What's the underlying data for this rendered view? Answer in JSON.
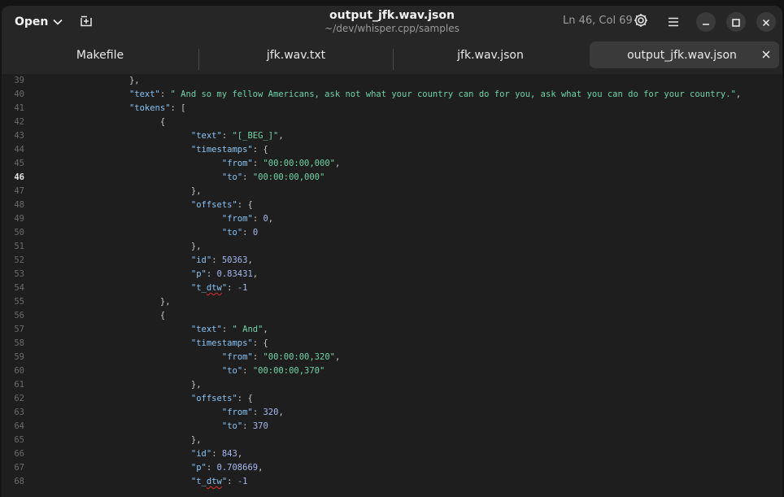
{
  "header": {
    "open_label": "Open",
    "title": "output_jfk.wav.json",
    "subtitle": "~/dev/whisper.cpp/samples",
    "cursor_position": "Ln 46, Col 69"
  },
  "tabs": [
    {
      "label": "Makefile"
    },
    {
      "label": "jfk.wav.txt"
    },
    {
      "label": "jfk.wav.json"
    },
    {
      "label": "output_jfk.wav.json"
    }
  ],
  "editor": {
    "current_line": 46,
    "lines": [
      {
        "n": "39",
        "indent": 6,
        "parts": [
          [
            "p",
            "},"
          ]
        ]
      },
      {
        "n": "40",
        "indent": 6,
        "parts": [
          [
            "k",
            "\"text\""
          ],
          [
            "p",
            ": "
          ],
          [
            "s",
            "\" And so my fellow Americans, ask not what your country can do for you, ask what you can do for your country.\""
          ],
          [
            "p",
            ","
          ]
        ]
      },
      {
        "n": "41",
        "indent": 6,
        "parts": [
          [
            "k",
            "\"tokens\""
          ],
          [
            "p",
            ": ["
          ]
        ]
      },
      {
        "n": "42",
        "indent": 8,
        "parts": [
          [
            "p",
            "{"
          ]
        ]
      },
      {
        "n": "43",
        "indent": 10,
        "parts": [
          [
            "k",
            "\"text\""
          ],
          [
            "p",
            ": "
          ],
          [
            "s",
            "\"[_BEG_]\""
          ],
          [
            "p",
            ","
          ]
        ]
      },
      {
        "n": "44",
        "indent": 10,
        "parts": [
          [
            "k",
            "\"timestamps\""
          ],
          [
            "p",
            ": {"
          ]
        ]
      },
      {
        "n": "45",
        "indent": 12,
        "parts": [
          [
            "k",
            "\"from\""
          ],
          [
            "p",
            ": "
          ],
          [
            "s",
            "\"00:00:00,000\""
          ],
          [
            "p",
            ","
          ]
        ]
      },
      {
        "n": "46",
        "indent": 12,
        "parts": [
          [
            "k",
            "\"to\""
          ],
          [
            "p",
            ": "
          ],
          [
            "s",
            "\"00:00:00,000\""
          ]
        ]
      },
      {
        "n": "47",
        "indent": 10,
        "parts": [
          [
            "p",
            "},"
          ]
        ]
      },
      {
        "n": "48",
        "indent": 10,
        "parts": [
          [
            "k",
            "\"offsets\""
          ],
          [
            "p",
            ": {"
          ]
        ]
      },
      {
        "n": "49",
        "indent": 12,
        "parts": [
          [
            "k",
            "\"from\""
          ],
          [
            "p",
            ": "
          ],
          [
            "n",
            "0"
          ],
          [
            "p",
            ","
          ]
        ]
      },
      {
        "n": "50",
        "indent": 12,
        "parts": [
          [
            "k",
            "\"to\""
          ],
          [
            "p",
            ": "
          ],
          [
            "n",
            "0"
          ]
        ]
      },
      {
        "n": "51",
        "indent": 10,
        "parts": [
          [
            "p",
            "},"
          ]
        ]
      },
      {
        "n": "52",
        "indent": 10,
        "parts": [
          [
            "k",
            "\"id\""
          ],
          [
            "p",
            ": "
          ],
          [
            "n",
            "50363"
          ],
          [
            "p",
            ","
          ]
        ]
      },
      {
        "n": "53",
        "indent": 10,
        "parts": [
          [
            "k",
            "\"p\""
          ],
          [
            "p",
            ": "
          ],
          [
            "n",
            "0.83431"
          ],
          [
            "p",
            ","
          ]
        ]
      },
      {
        "n": "54",
        "indent": 10,
        "parts": [
          [
            "k",
            "\"t_"
          ],
          [
            "kw",
            "dtw"
          ],
          [
            "k",
            "\""
          ],
          [
            "p",
            ": "
          ],
          [
            "n",
            "-1"
          ]
        ]
      },
      {
        "n": "55",
        "indent": 8,
        "parts": [
          [
            "p",
            "},"
          ]
        ]
      },
      {
        "n": "56",
        "indent": 8,
        "parts": [
          [
            "p",
            "{"
          ]
        ]
      },
      {
        "n": "57",
        "indent": 10,
        "parts": [
          [
            "k",
            "\"text\""
          ],
          [
            "p",
            ": "
          ],
          [
            "s",
            "\" And\""
          ],
          [
            "p",
            ","
          ]
        ]
      },
      {
        "n": "58",
        "indent": 10,
        "parts": [
          [
            "k",
            "\"timestamps\""
          ],
          [
            "p",
            ": {"
          ]
        ]
      },
      {
        "n": "59",
        "indent": 12,
        "parts": [
          [
            "k",
            "\"from\""
          ],
          [
            "p",
            ": "
          ],
          [
            "s",
            "\"00:00:00,320\""
          ],
          [
            "p",
            ","
          ]
        ]
      },
      {
        "n": "60",
        "indent": 12,
        "parts": [
          [
            "k",
            "\"to\""
          ],
          [
            "p",
            ": "
          ],
          [
            "s",
            "\"00:00:00,370\""
          ]
        ]
      },
      {
        "n": "61",
        "indent": 10,
        "parts": [
          [
            "p",
            "},"
          ]
        ]
      },
      {
        "n": "62",
        "indent": 10,
        "parts": [
          [
            "k",
            "\"offsets\""
          ],
          [
            "p",
            ": {"
          ]
        ]
      },
      {
        "n": "63",
        "indent": 12,
        "parts": [
          [
            "k",
            "\"from\""
          ],
          [
            "p",
            ": "
          ],
          [
            "n",
            "320"
          ],
          [
            "p",
            ","
          ]
        ]
      },
      {
        "n": "64",
        "indent": 12,
        "parts": [
          [
            "k",
            "\"to\""
          ],
          [
            "p",
            ": "
          ],
          [
            "n",
            "370"
          ]
        ]
      },
      {
        "n": "65",
        "indent": 10,
        "parts": [
          [
            "p",
            "},"
          ]
        ]
      },
      {
        "n": "66",
        "indent": 10,
        "parts": [
          [
            "k",
            "\"id\""
          ],
          [
            "p",
            ": "
          ],
          [
            "n",
            "843"
          ],
          [
            "p",
            ","
          ]
        ]
      },
      {
        "n": "67",
        "indent": 10,
        "parts": [
          [
            "k",
            "\"p\""
          ],
          [
            "p",
            ": "
          ],
          [
            "n",
            "0.708669"
          ],
          [
            "p",
            ","
          ]
        ]
      },
      {
        "n": "68",
        "indent": 10,
        "parts": [
          [
            "k",
            "\"t_"
          ],
          [
            "kw",
            "dtw"
          ],
          [
            "k",
            "\""
          ],
          [
            "p",
            ": "
          ],
          [
            "n",
            "-1"
          ]
        ]
      }
    ]
  },
  "icons": {
    "chevron": "chevron-down-icon",
    "new_tab": "new-tab-icon",
    "settings": "settings-icon",
    "menu": "hamburger-menu-icon",
    "minimize": "minimize-icon",
    "maximize": "maximize-icon",
    "close": "close-icon"
  },
  "colors": {
    "background": "#1e1e1e",
    "header": "#262626",
    "key": "#89c4f4",
    "string": "#6fd3a8",
    "number": "#a8b8f0",
    "spell_error": "#e03030"
  }
}
